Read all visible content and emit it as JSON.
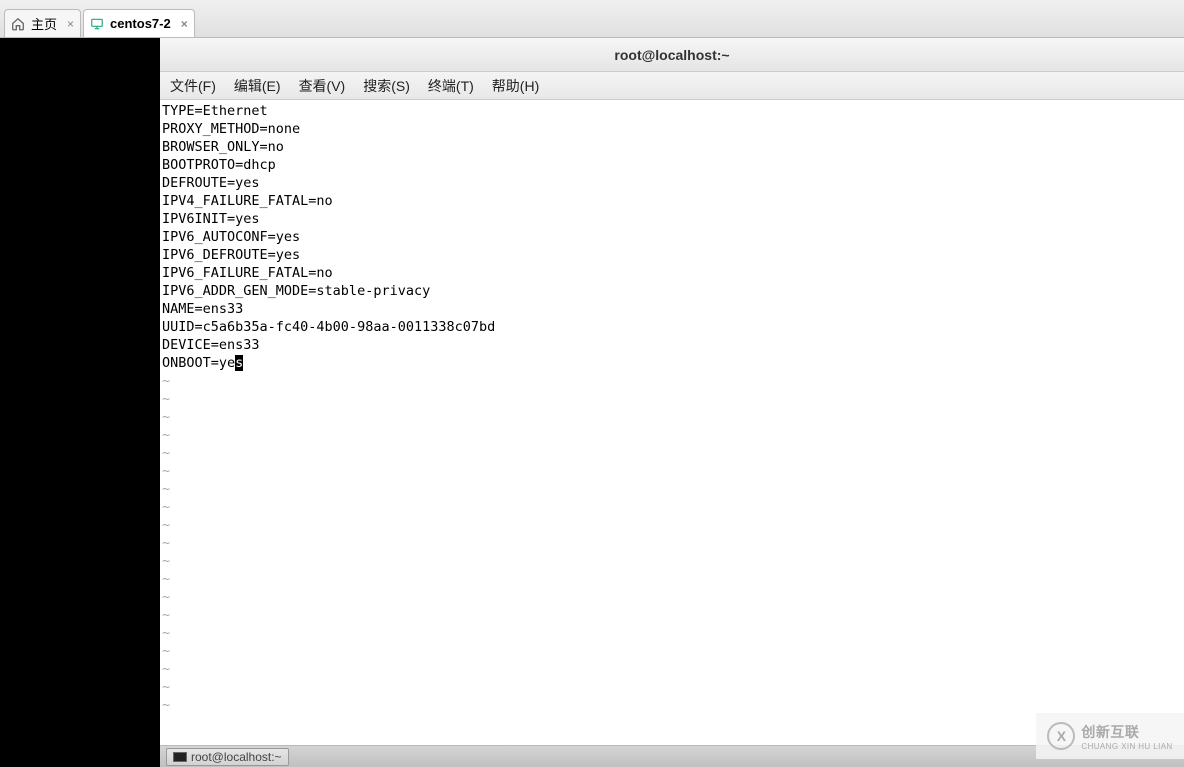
{
  "tabs": {
    "home_label": "主页",
    "vm_label": "centos7-2"
  },
  "title": "root@localhost:~",
  "menu": {
    "file": "文件(F)",
    "edit": "编辑(E)",
    "view": "查看(V)",
    "search": "搜索(S)",
    "terminal": "终端(T)",
    "help": "帮助(H)"
  },
  "file_lines": [
    "TYPE=Ethernet",
    "PROXY_METHOD=none",
    "BROWSER_ONLY=no",
    "BOOTPROTO=dhcp",
    "DEFROUTE=yes",
    "IPV4_FAILURE_FATAL=no",
    "IPV6INIT=yes",
    "IPV6_AUTOCONF=yes",
    "IPV6_DEFROUTE=yes",
    "IPV6_FAILURE_FATAL=no",
    "IPV6_ADDR_GEN_MODE=stable-privacy",
    "NAME=ens33",
    "UUID=c5a6b35a-fc40-4b00-98aa-0011338c07bd",
    "DEVICE=ens33"
  ],
  "last_line_prefix": "ONBOOT=ye",
  "last_line_cursor": "s",
  "tilde": "~",
  "tilde_count": 19,
  "taskbar": {
    "item_label": "root@localhost:~"
  },
  "watermark": {
    "logo_letter": "X",
    "text": "创新互联",
    "sub": "CHUANG XIN HU LIAN"
  }
}
